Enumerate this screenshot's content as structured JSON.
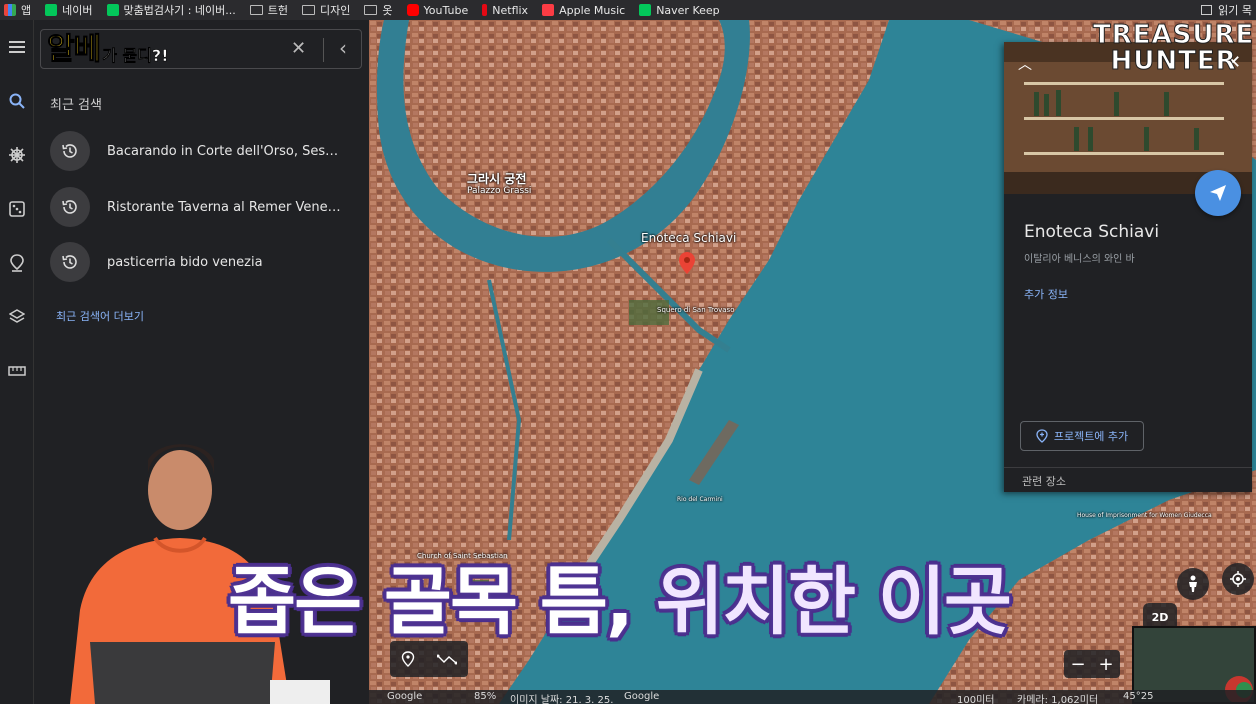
{
  "bookmarks": {
    "items": [
      {
        "label": "앱",
        "icon": "apps-grid-icon",
        "color": "#e8453c"
      },
      {
        "label": "네이버",
        "icon": "naver-icon",
        "color": "#03c75a"
      },
      {
        "label": "맞춤법검사기 : 네이버...",
        "icon": "naver-icon",
        "color": "#03c75a"
      },
      {
        "label": "트헌",
        "icon": "folder-icon",
        "color": ""
      },
      {
        "label": "디자인",
        "icon": "folder-icon",
        "color": ""
      },
      {
        "label": "옷",
        "icon": "folder-icon",
        "color": ""
      },
      {
        "label": "YouTube",
        "icon": "youtube-icon",
        "color": "#ff0000"
      },
      {
        "label": "Netflix",
        "icon": "netflix-icon",
        "color": "#e50914"
      },
      {
        "label": "Apple Music",
        "icon": "apple-music-icon",
        "color": "#fc3c44"
      },
      {
        "label": "Naver Keep",
        "icon": "naver-keep-icon",
        "color": "#03c75a"
      }
    ],
    "reading_list": "읽기 목"
  },
  "search": {
    "logo_big": "알베",
    "logo_small": "가 묻디?!"
  },
  "recent": {
    "title": "최근 검색",
    "items": [
      "Bacarando in Corte dell'Orso, Sestier...",
      "Ristorante Taverna al Remer Venezia...",
      "pasticerria bido venezia"
    ],
    "more": "최근 검색어 더보기"
  },
  "map": {
    "labels": {
      "palazzo_ko": "그라시 궁전",
      "palazzo_en": "Palazzo Grassi",
      "place": "Enoteca Schiavi",
      "squero": "Squero di San Trovaso",
      "rio": "Rio del Carmini",
      "church": "Church of Saint Sebastian",
      "house": "House of Imprisonment for Women Giudecca"
    }
  },
  "card": {
    "name": "Enoteca Schiavi",
    "subtitle": "이탈리아 베니스의 와인 바",
    "more_info": "추가 정보",
    "add_project": "프로젝트에 추가",
    "related": "관련 장소"
  },
  "watermark": {
    "line1": "TREASURE",
    "line2": "HUNTER"
  },
  "controls": {
    "mode_2d": "2D",
    "zoom_out": "−",
    "zoom_in": "+"
  },
  "status": {
    "google_left": "Google",
    "percent": "85%",
    "date": "이미지 날짜: 21. 3. 25.",
    "google_right": "Google",
    "scale": "100미터",
    "camera": "카메라: 1,062미터",
    "coords": "45°25"
  },
  "caption": {
    "part1": "좁은 골목 틈, ",
    "part2": "위치한 이곳"
  }
}
